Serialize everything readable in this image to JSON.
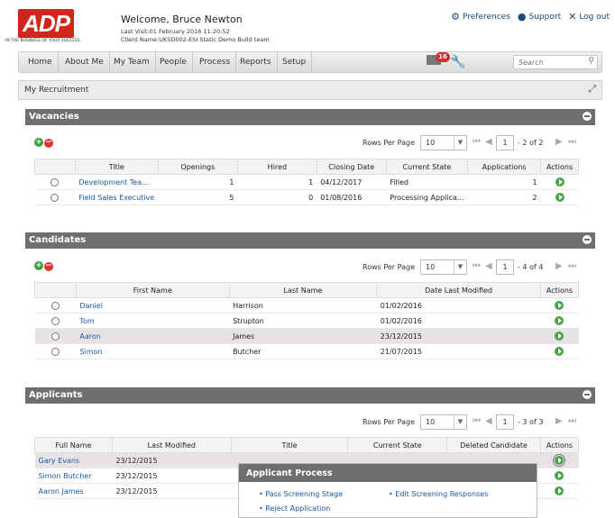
{
  "header": {
    "logo_text": "ADP",
    "tagline": "IN THE BUSINESS OF YOUR SUCCESS",
    "welcome": "Welcome, Bruce Newton",
    "last_visit": "Last Visit:01 February 2016 11:20:52",
    "client_name": "Client Name:UKSD002-ESI Static Demo Build team",
    "links": {
      "preferences": "Preferences",
      "support": "Support",
      "logout": "Log out"
    }
  },
  "nav": {
    "items": [
      "Home",
      "About Me",
      "My Team",
      "People",
      "Process",
      "Reports",
      "Setup"
    ],
    "mail_count": "16",
    "search_placeholder": "Search"
  },
  "panel_title": "My Recruitment",
  "vacancies": {
    "title": "Vacancies",
    "rows_per_page_label": "Rows Per Page",
    "rows_per_page": "10",
    "page": "1",
    "range": "- 2 of 2",
    "columns": [
      "Title",
      "Openings",
      "Hired",
      "Closing Date",
      "Current State",
      "Applications",
      "Actions"
    ],
    "rows": [
      {
        "title": "Development Tea...",
        "openings": "1",
        "hired": "1",
        "closing": "04/12/2017",
        "state": "Filled",
        "applications": "1"
      },
      {
        "title": "Field Sales Executive",
        "openings": "5",
        "hired": "0",
        "closing": "01/08/2016",
        "state": "Processing Applica...",
        "applications": "2"
      }
    ]
  },
  "candidates": {
    "title": "Candidates",
    "rows_per_page_label": "Rows Per Page",
    "rows_per_page": "10",
    "page": "1",
    "range": "- 4 of 4",
    "columns": [
      "First Name",
      "Last Name",
      "Date Last Modified",
      "Actions"
    ],
    "rows": [
      {
        "first": "Daniel",
        "last": "Harrison",
        "modified": "01/02/2016"
      },
      {
        "first": "Tom",
        "last": "Strupton",
        "modified": "01/02/2016"
      },
      {
        "first": "Aaron",
        "last": "James",
        "modified": "23/12/2015"
      },
      {
        "first": "Simon",
        "last": "Butcher",
        "modified": "21/07/2015"
      }
    ]
  },
  "applicants": {
    "title": "Applicants",
    "rows_per_page_label": "Rows Per Page",
    "rows_per_page": "10",
    "page": "1",
    "range": "- 3 of 3",
    "columns": [
      "Full Name",
      "Last Modified",
      "Title",
      "Current State",
      "Deleted Candidate",
      "Actions"
    ],
    "rows": [
      {
        "name": "Gary Evans",
        "modified": "23/12/2015"
      },
      {
        "name": "Simon Butcher",
        "modified": "23/12/2015"
      },
      {
        "name": "Aaron James",
        "modified": "23/12/2015"
      }
    ]
  },
  "popup": {
    "title": "Applicant Process",
    "items": [
      "Pass Screening Stage",
      "Edit Screening Responses",
      "Reject Application"
    ]
  }
}
